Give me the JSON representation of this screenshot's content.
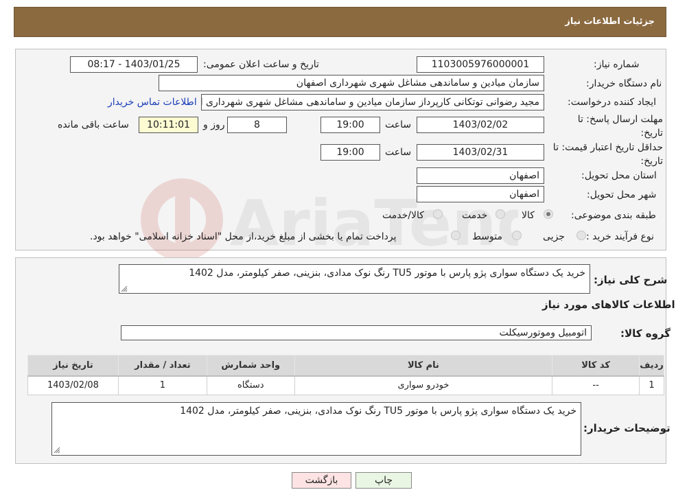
{
  "header": {
    "title": "جزئیات اطلاعات نیاز"
  },
  "form": {
    "need_number_label": "شماره نیاز:",
    "need_number": "1103005976000001",
    "announce_label": "تاریخ و ساعت اعلان عمومی:",
    "announce_value": "1403/01/25 - 08:17",
    "buyer_org_label": "نام دستگاه خریدار:",
    "buyer_org": "سازمان میادین و ساماندهی مشاغل شهری شهرداری اصفهان",
    "creator_label": "ایجاد کننده درخواست:",
    "creator": "مجید رضوانی توتکانی کارپرداز سازمان میادین و ساماندهی مشاغل شهری شهرداری اصفهان",
    "contact_link": "اطلاعات تماس خریدار",
    "deadline_label": "مهلت ارسال پاسخ: تا تاریخ:",
    "deadline_date": "1403/02/02",
    "time_label": "ساعت",
    "deadline_time": "19:00",
    "days_value": "8",
    "days_label": "روز و",
    "remaining_time": "10:11:01",
    "remaining_label": "ساعت باقی مانده",
    "validity_label": "حداقل تاریخ اعتبار قیمت: تا تاریخ:",
    "validity_date": "1403/02/31",
    "validity_time": "19:00",
    "province_label": "استان محل تحویل:",
    "province": "اصفهان",
    "city_label": "شهر محل تحویل:",
    "city": "اصفهان",
    "category_label": "طبقه بندی موضوعی:",
    "category_options": [
      "کالا",
      "خدمت",
      "کالا/خدمت"
    ],
    "process_label": "نوع فرآیند خرید :",
    "process_options": [
      "جزیی",
      "متوسط"
    ],
    "payment_note": "پرداخت تمام یا بخشی از مبلغ خرید،از محل \"اسناد خزانه اسلامی\" خواهد بود."
  },
  "details": {
    "summary_label": "شرح کلی نیاز:",
    "summary": "خرید یک دستگاه سواری پژو پارس با موتور TU5 رنگ نوک مدادی، بنزینی، صفر کیلومتر، مدل 1402",
    "goods_info_title": "اطلاعات کالاهای مورد نیاز",
    "goods_group_label": "گروه کالا:",
    "goods_group": "اتومبیل وموتورسیکلت",
    "table": {
      "headers": [
        "ردیف",
        "کد کالا",
        "نام کالا",
        "واحد شمارش",
        "تعداد / مقدار",
        "تاریخ نیاز"
      ],
      "rows": [
        [
          "1",
          "--",
          "خودرو سواری",
          "دستگاه",
          "1",
          "1403/02/08"
        ]
      ]
    },
    "buyer_notes_label": "توضیحات خریدار:",
    "buyer_notes": "خرید یک دستگاه سواری پژو پارس با موتور TU5 رنگ نوک مدادی، بنزینی، صفر کیلومتر، مدل 1402"
  },
  "buttons": {
    "print": "چاپ",
    "back": "بازگشت"
  },
  "watermark": "AriaTender.net",
  "colors": {
    "header_bg": "#8b6a40",
    "link": "#1a3db8",
    "back_button_bg": "#fde3e3",
    "print_button_bg": "#eaf6e4"
  }
}
